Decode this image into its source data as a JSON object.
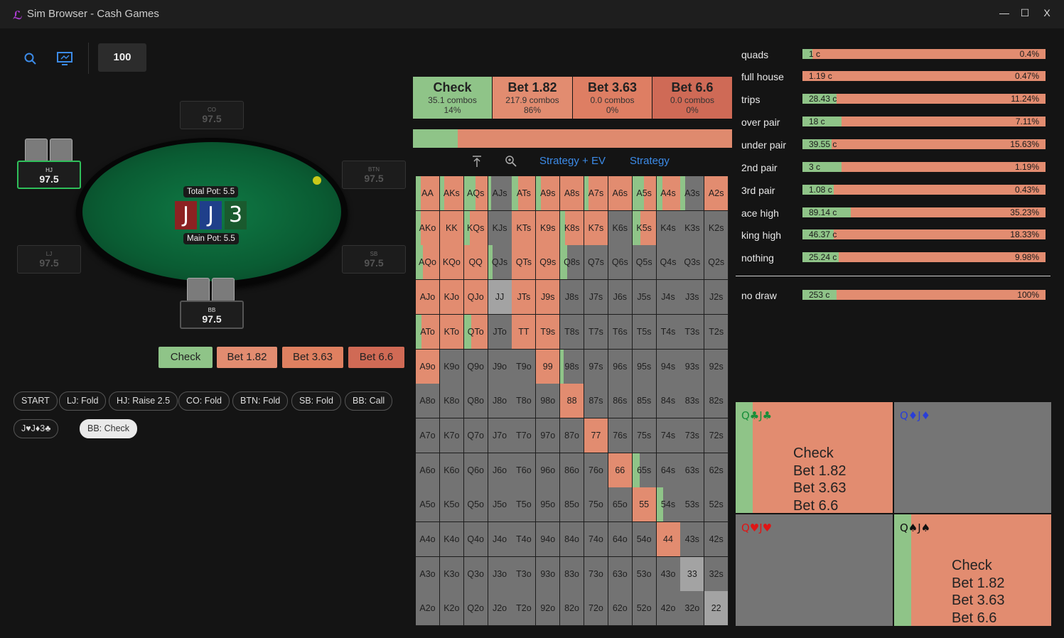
{
  "window": {
    "title": "Sim Browser - Cash Games",
    "min": "—",
    "max": "☐",
    "close": "X"
  },
  "toolbar": {
    "depth": "100"
  },
  "table": {
    "total_pot": "Total Pot: 5.5",
    "main_pot": "Main Pot: 5.5",
    "board": [
      {
        "rank": "J",
        "color": "#8c2222"
      },
      {
        "rank": "J",
        "color": "#1f3f8a"
      },
      {
        "rank": "3",
        "color": "#1a5a2e"
      }
    ],
    "seats": {
      "co": {
        "pos": "CO",
        "stack": "97.5"
      },
      "hj": {
        "pos": "HJ",
        "stack": "97.5"
      },
      "btn": {
        "pos": "BTN",
        "stack": "97.5"
      },
      "lj": {
        "pos": "LJ",
        "stack": "97.5"
      },
      "sb": {
        "pos": "SB",
        "stack": "97.5"
      },
      "bb": {
        "pos": "BB",
        "stack": "97.5"
      }
    }
  },
  "actions": [
    {
      "label": "Check",
      "color": "#8fc488"
    },
    {
      "label": "Bet 1.82",
      "color": "#e28c70"
    },
    {
      "label": "Bet 3.63",
      "color": "#df8060"
    },
    {
      "label": "Bet 6.6",
      "color": "#d06a55"
    }
  ],
  "history": [
    "START",
    "LJ: Fold",
    "HJ: Raise 2.5",
    "CO: Fold",
    "BTN: Fold",
    "SB: Fold",
    "BB: Call"
  ],
  "history2": [
    "J♥J♦3♣",
    "BB: Check"
  ],
  "summary": [
    {
      "name": "Check",
      "combos": "35.1 combos",
      "pct": "14%",
      "color": "#8fc488"
    },
    {
      "name": "Bet 1.82",
      "combos": "217.9 combos",
      "pct": "86%",
      "color": "#e28c70"
    },
    {
      "name": "Bet 3.63",
      "combos": "0.0 combos",
      "pct": "0%",
      "color": "#de7e63"
    },
    {
      "name": "Bet 6.6",
      "combos": "0.0 combos",
      "pct": "0%",
      "color": "#cf6a56"
    }
  ],
  "freq_check": 0.14,
  "view_tabs": {
    "strategy_ev": "Strategy + EV",
    "strategy": "Strategy"
  },
  "ranks": [
    "A",
    "K",
    "Q",
    "J",
    "T",
    "9",
    "8",
    "7",
    "6",
    "5",
    "4",
    "3",
    "2"
  ],
  "grid_special": {
    "AA": [
      [
        0,
        0.22,
        "#8fc488"
      ],
      [
        0.22,
        1,
        "#e28c70"
      ]
    ],
    "AKs": [
      [
        0,
        0.2,
        "#8fc488"
      ],
      [
        0.2,
        1,
        "#e28c70"
      ]
    ],
    "AQs": [
      [
        0,
        0.5,
        "#8fc488"
      ],
      [
        0.5,
        1,
        "#e28c70"
      ]
    ],
    "AJs": [
      [
        0,
        0.15,
        "#8fc488"
      ]
    ],
    "ATs": [
      [
        0,
        0.25,
        "#8fc488"
      ],
      [
        0.25,
        1,
        "#e28c70"
      ]
    ],
    "A9s": [
      [
        0,
        0.2,
        "#8fc488"
      ],
      [
        0.2,
        1,
        "#e28c70"
      ]
    ],
    "A8s": [
      [
        0,
        1,
        "#e28c70"
      ]
    ],
    "A7s": [
      [
        0,
        0.18,
        "#8fc488"
      ],
      [
        0.18,
        1,
        "#e28c70"
      ]
    ],
    "A6s": [
      [
        0,
        1,
        "#e28c70"
      ]
    ],
    "A5s": [
      [
        0,
        0.5,
        "#8fc488"
      ],
      [
        0.5,
        1,
        "#e28c70"
      ]
    ],
    "A4s": [
      [
        0,
        0.25,
        "#8fc488"
      ],
      [
        0.25,
        1,
        "#e28c70"
      ]
    ],
    "A3s": [
      [
        0,
        0.2,
        "#8fc488"
      ]
    ],
    "A2s": [
      [
        0,
        1,
        "#e28c70"
      ]
    ],
    "AKo": [
      [
        0,
        0.2,
        "#8fc488"
      ],
      [
        0.2,
        1,
        "#e28c70"
      ]
    ],
    "KK": [
      [
        0,
        1,
        "#e28c70"
      ]
    ],
    "KQs": [
      [
        0,
        0.25,
        "#8fc488"
      ],
      [
        0.25,
        1,
        "#e28c70"
      ]
    ],
    "KTs": [
      [
        0,
        1,
        "#e28c70"
      ]
    ],
    "K9s": [
      [
        0,
        1,
        "#e28c70"
      ]
    ],
    "K8s": [
      [
        0,
        0.2,
        "#8fc488"
      ],
      [
        0.2,
        1,
        "#e28c70"
      ]
    ],
    "K7s": [
      [
        0,
        1,
        "#e28c70"
      ]
    ],
    "K5s": [
      [
        0,
        0.35,
        "#8fc488"
      ],
      [
        0.35,
        1,
        "#e28c70"
      ]
    ],
    "AQo": [
      [
        0,
        0.3,
        "#8fc488"
      ],
      [
        0.3,
        1,
        "#e28c70"
      ]
    ],
    "KQo": [
      [
        0,
        1,
        "#e28c70"
      ]
    ],
    "QQ": [
      [
        0,
        1,
        "#e28c70"
      ]
    ],
    "QJs": [
      [
        0,
        0.2,
        "#8fc488"
      ]
    ],
    "QTs": [
      [
        0,
        1,
        "#e28c70"
      ]
    ],
    "Q9s": [
      [
        0,
        1,
        "#e28c70"
      ]
    ],
    "Q8s": [
      [
        0,
        0.3,
        "#8fc488"
      ]
    ],
    "AJo": [
      [
        0,
        1,
        "#e28c70"
      ]
    ],
    "KJo": [
      [
        0,
        1,
        "#e28c70"
      ]
    ],
    "QJo": [
      [
        0,
        1,
        "#e28c70"
      ]
    ],
    "JJ": [
      [
        0,
        1,
        "#a3a3a3"
      ]
    ],
    "JTs": [
      [
        0,
        1,
        "#e28c70"
      ]
    ],
    "J9s": [
      [
        0,
        1,
        "#e28c70"
      ]
    ],
    "ATo": [
      [
        0,
        0.25,
        "#8fc488"
      ],
      [
        0.25,
        1,
        "#e28c70"
      ]
    ],
    "KTo": [
      [
        0,
        1,
        "#e28c70"
      ]
    ],
    "QTo": [
      [
        0,
        0.3,
        "#8fc488"
      ],
      [
        0.3,
        1,
        "#e28c70"
      ]
    ],
    "TT": [
      [
        0,
        1,
        "#e28c70"
      ]
    ],
    "T9s": [
      [
        0,
        1,
        "#e28c70"
      ]
    ],
    "A9o": [
      [
        0,
        1,
        "#e28c70"
      ]
    ],
    "99": [
      [
        0,
        1,
        "#e28c70"
      ]
    ],
    "98s": [
      [
        0,
        0.15,
        "#8fc488"
      ]
    ],
    "88": [
      [
        0,
        1,
        "#e28c70"
      ]
    ],
    "77": [
      [
        0,
        1,
        "#e28c70"
      ]
    ],
    "66": [
      [
        0,
        1,
        "#e28c70"
      ]
    ],
    "65s": [
      [
        0,
        0.3,
        "#8fc488"
      ]
    ],
    "55": [
      [
        0,
        1,
        "#e28c70"
      ]
    ],
    "54s": [
      [
        0,
        0.3,
        "#8fc488"
      ]
    ],
    "44": [
      [
        0,
        1,
        "#e28c70"
      ]
    ],
    "33": [
      [
        0,
        1,
        "#a3a3a3"
      ]
    ],
    "22": [
      [
        0,
        1,
        "#a3a3a3"
      ]
    ]
  },
  "hand_stats": [
    {
      "label": "quads",
      "combos": "1 c",
      "pct": "0.4%",
      "g": 0.04
    },
    {
      "label": "full house",
      "combos": "1.19 c",
      "pct": "0.47%",
      "g": 0.0
    },
    {
      "label": "trips",
      "combos": "28.43 c",
      "pct": "11.24%",
      "g": 0.14
    },
    {
      "label": "over pair",
      "combos": "18 c",
      "pct": "7.11%",
      "g": 0.16
    },
    {
      "label": "under pair",
      "combos": "39.55 c",
      "pct": "15.63%",
      "g": 0.12
    },
    {
      "label": "2nd pair",
      "combos": "3 c",
      "pct": "1.19%",
      "g": 0.16
    },
    {
      "label": "3rd pair",
      "combos": "1.08 c",
      "pct": "0.43%",
      "g": 0.13
    },
    {
      "label": "ace high",
      "combos": "89.14 c",
      "pct": "35.23%",
      "g": 0.2
    },
    {
      "label": "king high",
      "combos": "46.37 c",
      "pct": "18.33%",
      "g": 0.13
    },
    {
      "label": "nothing",
      "combos": "25.24 c",
      "pct": "9.98%",
      "g": 0.15
    }
  ],
  "draw_stats": [
    {
      "label": "no draw",
      "combos": "253 c",
      "pct": "100%",
      "g": 0.14
    }
  ],
  "combos": [
    {
      "name": "Q♣J♣",
      "color": "#1a8f3a",
      "active": true,
      "rows": [
        [
          "Check",
          "11%"
        ],
        [
          "Bet 1.82",
          "89%"
        ],
        [
          "Bet 3.63",
          "0%"
        ],
        [
          "Bet 6.6",
          "0%"
        ]
      ]
    },
    {
      "name": "Q♦J♦",
      "color": "#2a3fd6",
      "active": false,
      "rows": []
    },
    {
      "name": "Q♥J♥",
      "color": "#e01515",
      "active": false,
      "rows": []
    },
    {
      "name": "Q♠J♠",
      "color": "#111111",
      "active": true,
      "rows": [
        [
          "Check",
          "10%"
        ],
        [
          "Bet 1.82",
          "90%"
        ],
        [
          "Bet 3.63",
          "0%"
        ],
        [
          "Bet 6.6",
          "0%"
        ]
      ]
    }
  ]
}
